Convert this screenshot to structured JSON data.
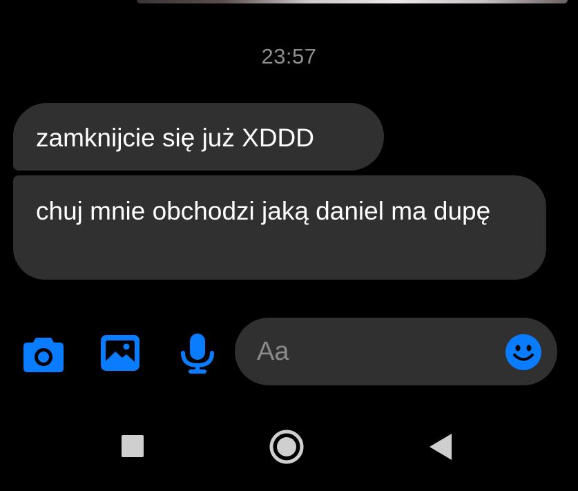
{
  "conversation": {
    "timestamp": "23:57",
    "messages": [
      {
        "text": "zamknijcie się już XDDD"
      },
      {
        "text": "chuj mnie obchodzi jaką daniel ma dupę"
      }
    ]
  },
  "composer": {
    "placeholder": "Aa",
    "accent_color": "#0a7cff",
    "actions": [
      "camera-icon",
      "image-icon",
      "microphone-icon"
    ],
    "trailing_action": "emoji-icon"
  },
  "navigation_bar": {
    "buttons": [
      "recent-apps-icon",
      "home-icon",
      "back-icon"
    ]
  },
  "colors": {
    "background": "#000000",
    "bubble": "#303030",
    "text": "#ffffff",
    "timestamp": "#8e8e8e",
    "nav_icons": "#cfcfcf"
  }
}
